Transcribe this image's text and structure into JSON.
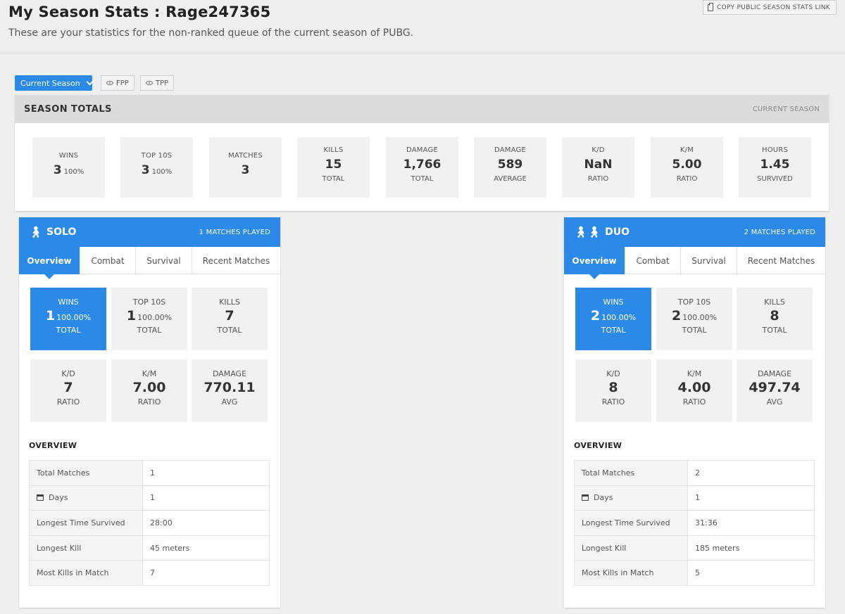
{
  "header": {
    "title": "My Season Stats : Rage247365",
    "subtitle": "These are your statistics for the non-ranked queue of the current season of PUBG.",
    "copy_link_label": "COPY PUBLIC SEASON STATS LINK"
  },
  "filters": {
    "season_label": "Current Season",
    "fpp_label": "FPP",
    "tpp_label": "TPP"
  },
  "season_totals": {
    "title": "SEASON TOTALS",
    "subtitle": "CURRENT SEASON",
    "stats": [
      {
        "label": "WINS",
        "value": "3",
        "pct": "100%",
        "foot": ""
      },
      {
        "label": "TOP 10S",
        "value": "3",
        "pct": "100%",
        "foot": ""
      },
      {
        "label": "MATCHES",
        "value": "3",
        "pct": "",
        "foot": ""
      },
      {
        "label": "KILLS",
        "value": "15",
        "pct": "",
        "foot": "TOTAL"
      },
      {
        "label": "DAMAGE",
        "value": "1,766",
        "pct": "",
        "foot": "TOTAL"
      },
      {
        "label": "DAMAGE",
        "value": "589",
        "pct": "",
        "foot": "AVERAGE"
      },
      {
        "label": "K/D",
        "value": "NaN",
        "pct": "",
        "foot": "RATIO"
      },
      {
        "label": "K/M",
        "value": "5.00",
        "pct": "",
        "foot": "RATIO"
      },
      {
        "label": "HOURS",
        "value": "1.45",
        "pct": "",
        "foot": "SURVIVED"
      }
    ]
  },
  "tabs": [
    "Overview",
    "Combat",
    "Survival",
    "Recent Matches"
  ],
  "overview_title": "OVERVIEW",
  "solo": {
    "name": "SOLO",
    "played": "1 MATCHES PLAYED",
    "tiles": [
      {
        "label": "WINS",
        "value": "1",
        "pct": "100.00%",
        "foot": "TOTAL"
      },
      {
        "label": "TOP 10S",
        "value": "1",
        "pct": "100.00%",
        "foot": "TOTAL"
      },
      {
        "label": "KILLS",
        "value": "7",
        "pct": "",
        "foot": "TOTAL"
      },
      {
        "label": "K/D",
        "value": "7",
        "pct": "",
        "foot": "RATIO"
      },
      {
        "label": "K/M",
        "value": "7.00",
        "pct": "",
        "foot": "RATIO"
      },
      {
        "label": "DAMAGE",
        "value": "770.11",
        "pct": "",
        "foot": "AVG"
      }
    ],
    "overview": [
      {
        "key": "Total Matches",
        "value": "1"
      },
      {
        "key": "Days",
        "value": "1"
      },
      {
        "key": "Longest Time Survived",
        "value": "28:00"
      },
      {
        "key": "Longest Kill",
        "value": "45 meters"
      },
      {
        "key": "Most Kills in Match",
        "value": "7"
      }
    ]
  },
  "duo": {
    "name": "DUO",
    "played": "2 MATCHES PLAYED",
    "tiles": [
      {
        "label": "WINS",
        "value": "2",
        "pct": "100.00%",
        "foot": "TOTAL"
      },
      {
        "label": "TOP 10S",
        "value": "2",
        "pct": "100.00%",
        "foot": "TOTAL"
      },
      {
        "label": "KILLS",
        "value": "8",
        "pct": "",
        "foot": "TOTAL"
      },
      {
        "label": "K/D",
        "value": "8",
        "pct": "",
        "foot": "RATIO"
      },
      {
        "label": "K/M",
        "value": "4.00",
        "pct": "",
        "foot": "RATIO"
      },
      {
        "label": "DAMAGE",
        "value": "497.74",
        "pct": "",
        "foot": "AVG"
      }
    ],
    "overview": [
      {
        "key": "Total Matches",
        "value": "2"
      },
      {
        "key": "Days",
        "value": "1"
      },
      {
        "key": "Longest Time Survived",
        "value": "31:36"
      },
      {
        "key": "Longest Kill",
        "value": "185 meters"
      },
      {
        "key": "Most Kills in Match",
        "value": "5"
      }
    ]
  }
}
